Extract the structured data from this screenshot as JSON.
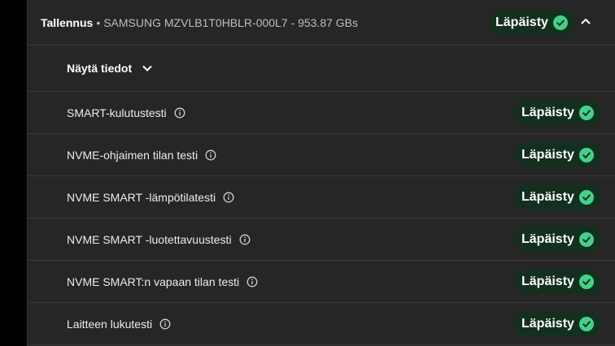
{
  "header": {
    "category": "Tallennus",
    "separator": "•",
    "device": "SAMSUNG MZVLB1T0HBLR-000L7 - 953.87 GBs",
    "status": "Läpäisty"
  },
  "details": {
    "label": "Näytä tiedot"
  },
  "tests": [
    {
      "label": "SMART-kulutustesti",
      "status": "Läpäisty"
    },
    {
      "label": "NVME-ohjaimen tilan testi",
      "status": "Läpäisty"
    },
    {
      "label": "NVME SMART -lämpötilatesti",
      "status": "Läpäisty"
    },
    {
      "label": "NVME SMART -luotettavuustesti",
      "status": "Läpäisty"
    },
    {
      "label": "NVME SMART:n vapaan tilan testi",
      "status": "Läpäisty"
    },
    {
      "label": "Laitteen lukutesti",
      "status": "Läpäisty"
    }
  ],
  "colors": {
    "panel": "#262626",
    "badge_bg": "#13301f",
    "check": "#45d08a"
  },
  "icons": {
    "status": "check-circle-icon",
    "collapse": "chevron-up-icon",
    "expand": "chevron-down-icon",
    "info": "info-icon"
  }
}
